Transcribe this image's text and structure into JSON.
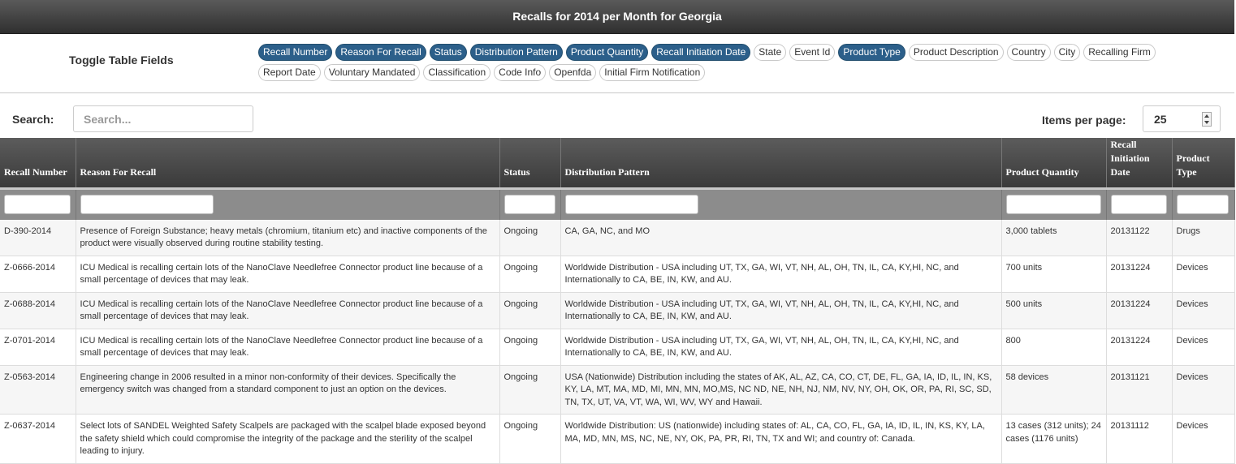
{
  "page": {
    "title": "Recalls for 2014 per Month for Georgia"
  },
  "toggle": {
    "title": "Toggle Table Fields",
    "fields": [
      {
        "label": "Recall Number",
        "active": true
      },
      {
        "label": "Reason For Recall",
        "active": true
      },
      {
        "label": "Status",
        "active": true
      },
      {
        "label": "Distribution Pattern",
        "active": true
      },
      {
        "label": "Product Quantity",
        "active": true
      },
      {
        "label": "Recall Initiation Date",
        "active": true
      },
      {
        "label": "State",
        "active": false
      },
      {
        "label": "Event Id",
        "active": false
      },
      {
        "label": "Product Type",
        "active": true
      },
      {
        "label": "Product Description",
        "active": false
      },
      {
        "label": "Country",
        "active": false
      },
      {
        "label": "City",
        "active": false
      },
      {
        "label": "Recalling Firm",
        "active": false
      },
      {
        "label": "Report Date",
        "active": false
      },
      {
        "label": "Voluntary Mandated",
        "active": false
      },
      {
        "label": "Classification",
        "active": false
      },
      {
        "label": "Code Info",
        "active": false
      },
      {
        "label": "Openfda",
        "active": false
      },
      {
        "label": "Initial Firm Notification",
        "active": false
      }
    ]
  },
  "search": {
    "label": "Search:",
    "placeholder": "Search...",
    "value": ""
  },
  "pagination": {
    "label": "Items per page:",
    "value": "25"
  },
  "table": {
    "columns": [
      "Recall Number",
      "Reason For Recall",
      "Status",
      "Distribution Pattern",
      "Product Quantity",
      "Recall Initiation Date",
      "Product Type"
    ],
    "rows": [
      [
        "D-390-2014",
        "Presence of Foreign Substance; heavy metals (chromium, titanium etc) and inactive components of the product were visually observed during routine stability testing.",
        "Ongoing",
        "CA, GA, NC, and MO",
        "3,000 tablets",
        "20131122",
        "Drugs"
      ],
      [
        "Z-0666-2014",
        "ICU Medical is recalling certain lots of the NanoClave Needlefree Connector product line because of a small percentage of devices that may leak.",
        "Ongoing",
        "Worldwide Distribution - USA including UT, TX, GA, WI, VT, NH, AL, OH, TN, IL, CA, KY,HI, NC, and Internationally to CA, BE, IN, KW, and AU.",
        "700 units",
        "20131224",
        "Devices"
      ],
      [
        "Z-0688-2014",
        "ICU Medical is recalling certain lots of the NanoClave Needlefree Connector product line because of a small percentage of devices that may leak.",
        "Ongoing",
        "Worldwide Distribution - USA including UT, TX, GA, WI, VT, NH, AL, OH, TN, IL, CA, KY,HI, NC, and Internationally to CA, BE, IN, KW, and AU.",
        "500 units",
        "20131224",
        "Devices"
      ],
      [
        "Z-0701-2014",
        "ICU Medical is recalling certain lots of the NanoClave Needlefree Connector product line because of a small percentage of devices that may leak.",
        "Ongoing",
        "Worldwide Distribution - USA including UT, TX, GA, WI, VT, NH, AL, OH, TN, IL, CA, KY,HI, NC, and Internationally to CA, BE, IN, KW, and AU.",
        "800",
        "20131224",
        "Devices"
      ],
      [
        "Z-0563-2014",
        "Engineering change in 2006 resulted in a minor non-conformity of their devices. Specifically the emergency switch was changed from a standard component to just an option on the devices.",
        "Ongoing",
        "USA (Nationwide) Distribution including the states of AK, AL, AZ, CA, CO, CT, DE, FL, GA, IA, ID, IL, IN, KS, KY, LA, MT, MA, MD, MI, MN, MN, MO,MS, NC ND, NE, NH, NJ, NM, NV, NY, OH, OK, OR, PA, RI, SC, SD, TN, TX, UT, VA, VT, WA, WI, WV, WY and Hawaii.",
        "58 devices",
        "20131121",
        "Devices"
      ],
      [
        "Z-0637-2014",
        "Select lots of SANDEL Weighted Safety Scalpels are packaged with the scalpel blade exposed beyond the safety shield which could compromise the integrity of the package and the sterility of the scalpel leading to injury.",
        "Ongoing",
        "Worldwide Distribution: US (nationwide) including states of: AL, CA, CO, FL, GA, IA, ID, IL, IN, KS, KY, LA, MA, MD, MN, MS, NC, NE, NY, OK, PA, PR, RI, TN, TX and WI; and country of: Canada.",
        "13 cases (312 units); 24 cases (1176 units)",
        "20131112",
        "Devices"
      ]
    ]
  }
}
